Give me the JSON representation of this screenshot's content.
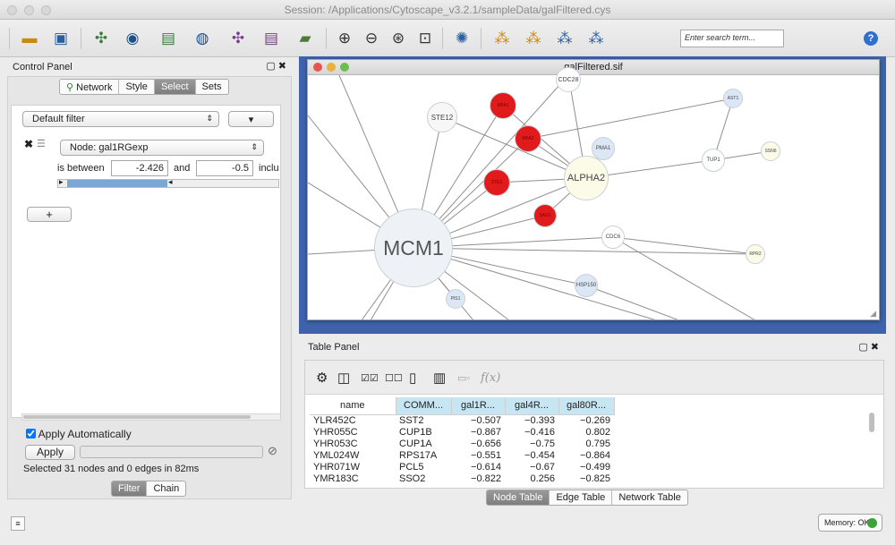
{
  "window": {
    "title": "Session: /Applications/Cytoscape_v3.2.1/sampleData/galFiltered.cys"
  },
  "toolbar": {
    "search_placeholder": "Enter search term...",
    "help_label": "?"
  },
  "control_panel": {
    "title": "Control Panel",
    "header_controls": "▢ ✖",
    "tabs": [
      "Network",
      "Style",
      "Select",
      "Sets"
    ],
    "selected_tab": "Select",
    "filter_dropdown": "Default filter",
    "filter_menu_button": "▾",
    "condition": {
      "column": "Node: gal1RGexp",
      "operator_text": "is between",
      "low_value": "-2.426",
      "and_text": "and",
      "high_value": "-0.5",
      "inclusive_text": "inclu"
    },
    "add_button": "+",
    "apply_automatically_label": "Apply Automatically",
    "apply_automatically_checked": true,
    "apply_button": "Apply",
    "status": "Selected 31 nodes and 0 edges in 82ms",
    "bottom_tabs": [
      "Filter",
      "Chain"
    ],
    "bottom_selected": "Filter"
  },
  "network_view": {
    "title": "galFiltered.sif",
    "nodes": [
      {
        "label": "MCM1",
        "color": "#eef2f6"
      },
      {
        "label": "ALPHA2",
        "color": "#fbfbe8"
      },
      {
        "label": "STE12",
        "color": "#f7f7f7"
      },
      {
        "label": "CDC28",
        "color": "#ffffff"
      },
      {
        "label": "PMA1",
        "color": "#dbe7f5"
      },
      {
        "label": "AST1",
        "color": "#dbe7f5"
      },
      {
        "label": "TUP1",
        "color": "#ffffff"
      },
      {
        "label": "SSN6",
        "color": "#fbfbe8"
      },
      {
        "label": "CDC6",
        "color": "#ffffff"
      },
      {
        "label": "RPR2",
        "color": "#fbfbe8"
      },
      {
        "label": "HSP150",
        "color": "#dbe7f5"
      },
      {
        "label": "PIS1",
        "color": "#dbe7f5"
      },
      {
        "label": "MFA1",
        "color": "#e11b1b"
      },
      {
        "label": "MFA2",
        "color": "#e11b1b"
      },
      {
        "label": "STE2",
        "color": "#e11b1b"
      },
      {
        "label": "SAG1",
        "color": "#e11b1b"
      }
    ]
  },
  "table_panel": {
    "title": "Table Panel",
    "header_controls": "▢ ✖",
    "columns": [
      "name",
      "COMM...",
      "gal1R...",
      "gal4R...",
      "gal80R..."
    ],
    "rows": [
      [
        "YLR452C",
        "SST2",
        "−0.507",
        "−0.393",
        "−0.269"
      ],
      [
        "YHR055C",
        "CUP1B",
        "−0.867",
        "−0.416",
        "0.802"
      ],
      [
        "YHR053C",
        "CUP1A",
        "−0.656",
        "−0.75",
        "0.795"
      ],
      [
        "YML024W",
        "RPS17A",
        "−0.551",
        "−0.454",
        "−0.864"
      ],
      [
        "YHR071W",
        "PCL5",
        "−0.614",
        "−0.67",
        "−0.499"
      ],
      [
        "YMR183C",
        "SSO2",
        "−0.822",
        "0.256",
        "−0.825"
      ]
    ],
    "tabs": [
      "Node Table",
      "Edge Table",
      "Network Table"
    ],
    "selected_tab": "Node Table"
  },
  "status_bar": {
    "memory_label": "Memory: OK"
  },
  "colors": {
    "accent": "#3e62ac",
    "selected_node": "#e11b1b",
    "memory_ok": "#3aa43a",
    "column_highlight": "#c7e6f4"
  },
  "icons": [
    "open-folder-icon",
    "save-icon",
    "import-network-icon",
    "import-network-db-icon",
    "import-table-icon",
    "import-table-db-icon",
    "export-network-icon",
    "export-table-icon",
    "export-image-icon",
    "zoom-in-icon",
    "zoom-out-icon",
    "zoom-selected-icon",
    "zoom-fit-icon",
    "layout-icon",
    "select-first-neighbors-icon",
    "hide-icon",
    "show-all-icon",
    "expand-icon"
  ]
}
